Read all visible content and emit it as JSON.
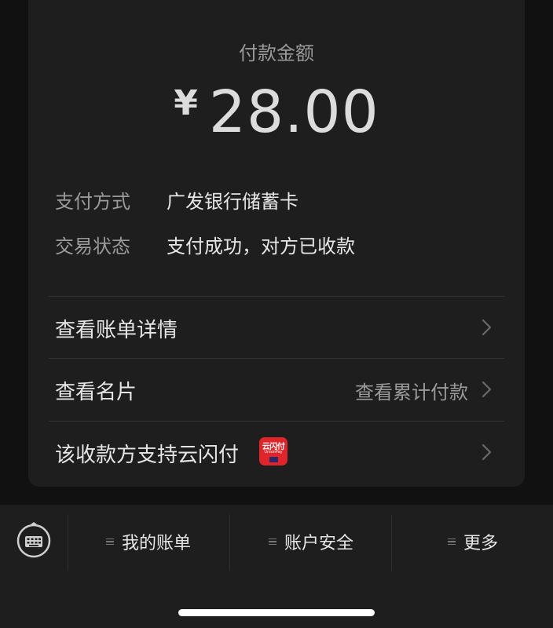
{
  "payment": {
    "amount_label": "付款金额",
    "currency_symbol": "¥",
    "amount": "28.00"
  },
  "details": [
    {
      "label": "支付方式",
      "value": "广发银行储蓄卡"
    },
    {
      "label": "交易状态",
      "value": "支付成功，对方已收款"
    }
  ],
  "links": [
    {
      "label": "查看账单详情",
      "hint": ""
    },
    {
      "label": "查看名片",
      "hint": "查看累计付款"
    },
    {
      "label": "该收款方支持云闪付",
      "hint": "",
      "badge_text": "云闪付",
      "badge_sub": "UnionPay"
    }
  ],
  "bottom_tabs": [
    {
      "label": "我的账单"
    },
    {
      "label": "账户安全"
    },
    {
      "label": "更多"
    }
  ],
  "icons": {
    "chevron": "chevron-right-icon",
    "keyboard": "keyboard-icon",
    "menu": "menu-icon",
    "unionpay": "unionpay-icon"
  },
  "colors": {
    "background": "#111111",
    "card": "#1e1e1e",
    "primary_text": "#e6e6e6",
    "secondary_text": "#9a9a9a",
    "badge_red": "#e0252a"
  }
}
